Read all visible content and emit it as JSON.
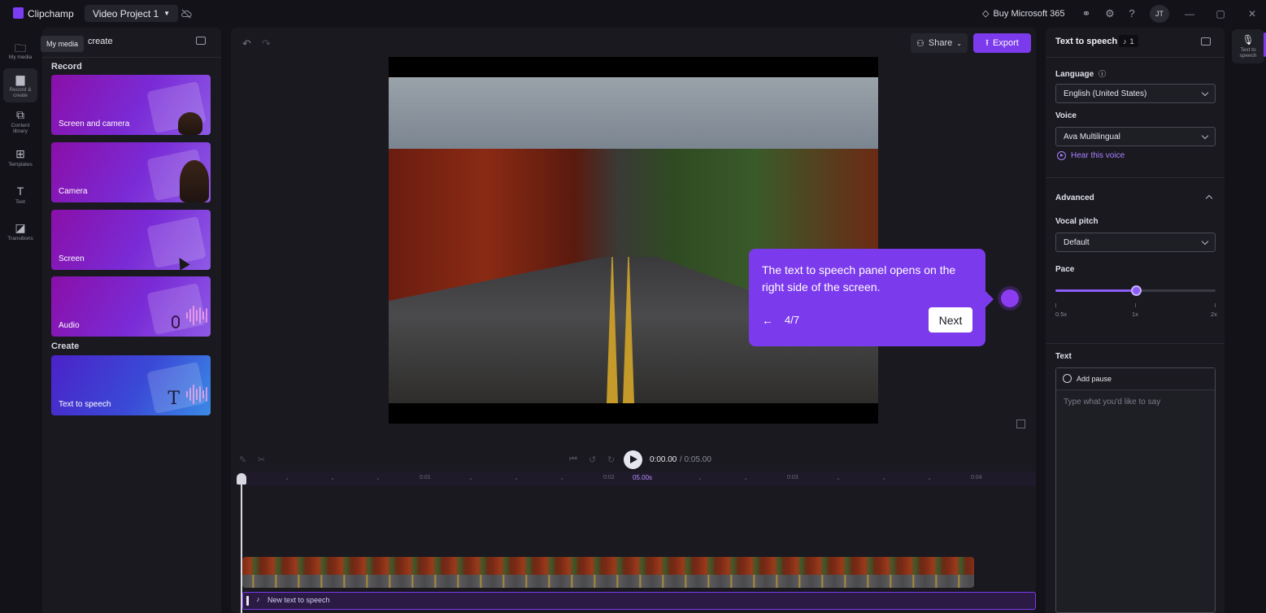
{
  "titlebar": {
    "app_name": "Clipchamp",
    "project_name": "Video Project 1",
    "buy_label": "Buy Microsoft 365",
    "avatar_initials": "JT",
    "icons": [
      "cloud-off-icon",
      "diamond-icon",
      "share-link-icon",
      "gear-icon",
      "help-icon",
      "minimize-icon",
      "maximize-icon",
      "close-icon"
    ]
  },
  "leftnav": {
    "items": [
      {
        "label": "My media",
        "icon": "folder-icon"
      },
      {
        "label": "Record & create",
        "icon": "camera-icon",
        "active": true
      },
      {
        "label": "Content library",
        "icon": "library-icon"
      },
      {
        "label": "Templates",
        "icon": "templates-icon"
      },
      {
        "label": "Text",
        "icon": "text-icon"
      },
      {
        "label": "Transitions",
        "icon": "transitions-icon"
      }
    ],
    "tooltip": "My media"
  },
  "mediapanel": {
    "title": "create",
    "record_heading": "Record",
    "create_heading": "Create",
    "cards": [
      {
        "label": "Screen and camera"
      },
      {
        "label": "Camera"
      },
      {
        "label": "Screen"
      },
      {
        "label": "Audio"
      },
      {
        "label": "Text to speech"
      }
    ]
  },
  "toolbar": {
    "share_label": "Share",
    "export_label": "Export"
  },
  "coachmark": {
    "text": "The text to speech panel opens on the right side of the screen.",
    "back_label": "←",
    "step": "4/7",
    "next_label": "Next"
  },
  "playback": {
    "current_time": "0:00.00",
    "total_time": "/ 0:05.00"
  },
  "timeline": {
    "ruler_labels": [
      "0:01",
      "0:02",
      "05.00s",
      "0:03",
      "0:04"
    ],
    "tts_clip_label": "New text to speech"
  },
  "rightpanel": {
    "title": "Text to speech",
    "badge_count": "1",
    "language_label": "Language",
    "language_value": "English (United States)",
    "voice_label": "Voice",
    "voice_value": "Ava Multilingual",
    "hear_voice": "Hear this voice",
    "advanced_label": "Advanced",
    "pitch_label": "Vocal pitch",
    "pitch_value": "Default",
    "pace_label": "Pace",
    "pace_value": 0.5,
    "pace_ticks": [
      "0.5x",
      "1x",
      "2x"
    ],
    "text_label": "Text",
    "add_pause": "Add pause",
    "text_placeholder": "Type what you'd like to say"
  },
  "farright": {
    "item_label": "Text to speech"
  },
  "colors": {
    "accent": "#7c3aed",
    "link": "#a881ff",
    "background": "#121218",
    "panel": "#19191f"
  }
}
